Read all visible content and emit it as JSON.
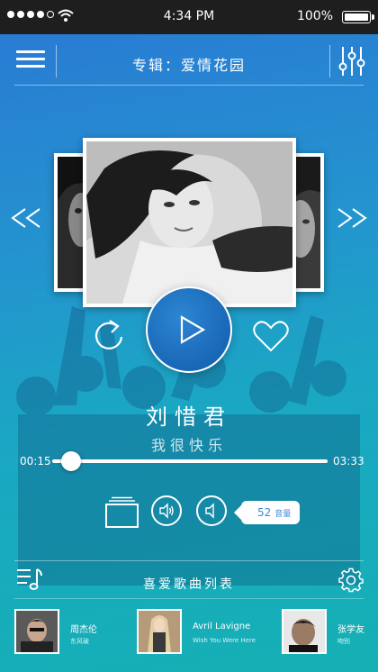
{
  "status_bar": {
    "time": "4:34 PM",
    "battery_percent": "100%",
    "signal_dots_filled": 4,
    "signal_dots_total": 5
  },
  "header": {
    "album_title": "专辑：爱情花园",
    "menu_icon": "hamburger-menu-icon",
    "equalizer_icon": "equalizer-sliders-icon"
  },
  "carousel": {
    "prev_icon": "double-chevron-left-icon",
    "next_icon": "double-chevron-right-icon"
  },
  "now_playing": {
    "artist": "刘惜君",
    "song": "我很快乐",
    "elapsed": "00:15",
    "duration": "03:33",
    "progress_fraction": 0.07
  },
  "controls": {
    "play_icon": "play-icon",
    "repeat_icon": "repeat-icon",
    "favorite_icon": "heart-icon",
    "cards_icon": "card-stack-icon",
    "volume_icon": "speaker-on-icon",
    "volume_low_icon": "speaker-low-icon",
    "volume_value": "52",
    "volume_unit": "音量"
  },
  "favorites": {
    "title": "喜爱歌曲列表",
    "playlist_icon": "playlist-icon",
    "settings_icon": "gear-icon",
    "items": [
      {
        "artist": "周杰伦",
        "song": "东风破"
      },
      {
        "artist": "Avril Lavigne",
        "song": "Wish You Were Here"
      },
      {
        "artist": "张学友",
        "song": "吻别"
      }
    ]
  },
  "colors": {
    "gradient_top": "#2a78d4",
    "gradient_bottom": "#15b0b4",
    "play_button": "#1765b5",
    "volume_text": "#3d8bd4",
    "status_bar": "#1e1e1e"
  }
}
